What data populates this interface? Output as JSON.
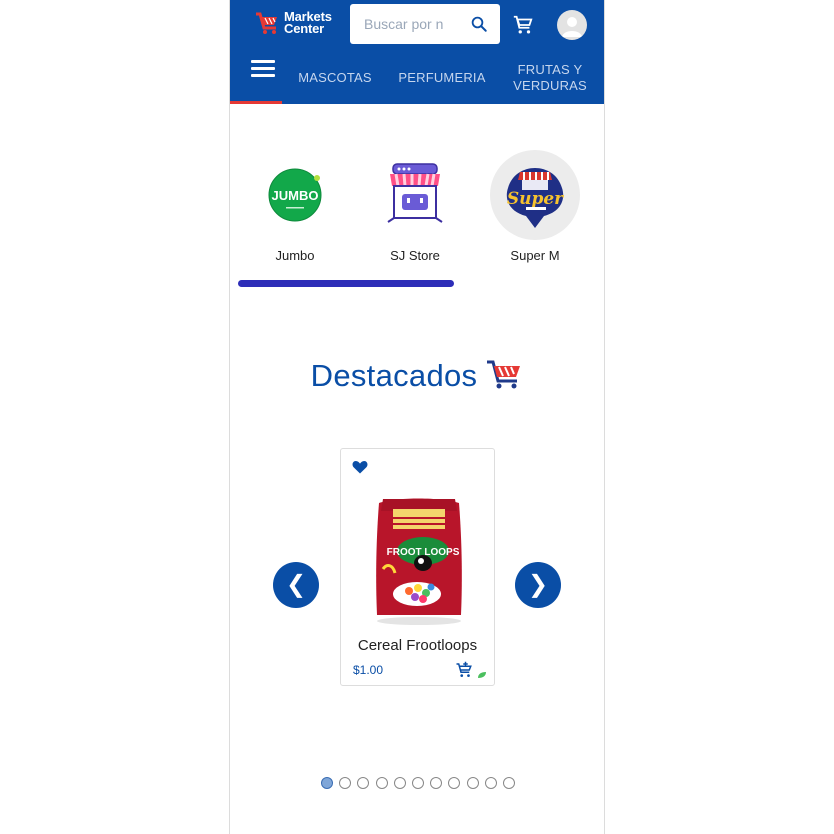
{
  "header": {
    "logo_line1": "Markets",
    "logo_line2": "Center",
    "search_placeholder": "Buscar por n",
    "nav_tabs": [
      "MASCOTAS",
      "PERFUMERIA",
      "FRUTAS Y VERDURAS"
    ],
    "nav_tab3_line1": "FRUTAS Y",
    "nav_tab3_line2": "VERDURAS",
    "brand_color": "#0a4ea6",
    "active_indicator_color": "#e53935"
  },
  "stores": [
    {
      "name": "Jumbo",
      "logo_text": "JUMBO"
    },
    {
      "name": "SJ Store"
    },
    {
      "name": "Super M",
      "logo_text": "Super"
    }
  ],
  "featured": {
    "title": "Destacados",
    "product": {
      "name": "Cereal Frootloops",
      "price": "$1.00",
      "package_text": "FROOT LOOPS",
      "favorited": true
    },
    "prev_label": "❮",
    "next_label": "❯",
    "pagination": {
      "total": 11,
      "active": 0
    }
  }
}
